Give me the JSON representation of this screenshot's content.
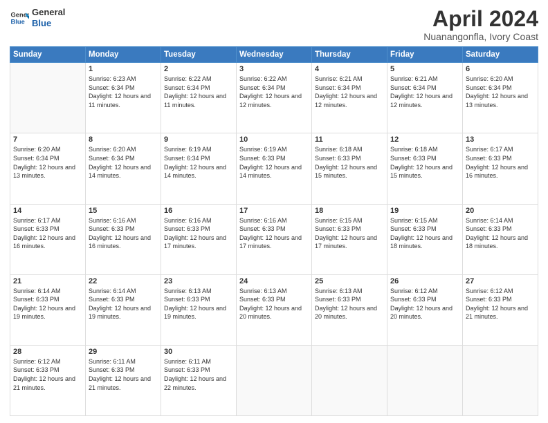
{
  "logo": {
    "line1": "General",
    "line2": "Blue"
  },
  "title": "April 2024",
  "subtitle": "Nuanangonfla, Ivory Coast",
  "days_of_week": [
    "Sunday",
    "Monday",
    "Tuesday",
    "Wednesday",
    "Thursday",
    "Friday",
    "Saturday"
  ],
  "weeks": [
    [
      {
        "day": "",
        "sunrise": "",
        "sunset": "",
        "daylight": ""
      },
      {
        "day": "1",
        "sunrise": "6:23 AM",
        "sunset": "6:34 PM",
        "daylight": "12 hours and 11 minutes."
      },
      {
        "day": "2",
        "sunrise": "6:22 AM",
        "sunset": "6:34 PM",
        "daylight": "12 hours and 11 minutes."
      },
      {
        "day": "3",
        "sunrise": "6:22 AM",
        "sunset": "6:34 PM",
        "daylight": "12 hours and 12 minutes."
      },
      {
        "day": "4",
        "sunrise": "6:21 AM",
        "sunset": "6:34 PM",
        "daylight": "12 hours and 12 minutes."
      },
      {
        "day": "5",
        "sunrise": "6:21 AM",
        "sunset": "6:34 PM",
        "daylight": "12 hours and 12 minutes."
      },
      {
        "day": "6",
        "sunrise": "6:20 AM",
        "sunset": "6:34 PM",
        "daylight": "12 hours and 13 minutes."
      }
    ],
    [
      {
        "day": "7",
        "sunrise": "6:20 AM",
        "sunset": "6:34 PM",
        "daylight": "12 hours and 13 minutes."
      },
      {
        "day": "8",
        "sunrise": "6:20 AM",
        "sunset": "6:34 PM",
        "daylight": "12 hours and 14 minutes."
      },
      {
        "day": "9",
        "sunrise": "6:19 AM",
        "sunset": "6:34 PM",
        "daylight": "12 hours and 14 minutes."
      },
      {
        "day": "10",
        "sunrise": "6:19 AM",
        "sunset": "6:33 PM",
        "daylight": "12 hours and 14 minutes."
      },
      {
        "day": "11",
        "sunrise": "6:18 AM",
        "sunset": "6:33 PM",
        "daylight": "12 hours and 15 minutes."
      },
      {
        "day": "12",
        "sunrise": "6:18 AM",
        "sunset": "6:33 PM",
        "daylight": "12 hours and 15 minutes."
      },
      {
        "day": "13",
        "sunrise": "6:17 AM",
        "sunset": "6:33 PM",
        "daylight": "12 hours and 16 minutes."
      }
    ],
    [
      {
        "day": "14",
        "sunrise": "6:17 AM",
        "sunset": "6:33 PM",
        "daylight": "12 hours and 16 minutes."
      },
      {
        "day": "15",
        "sunrise": "6:16 AM",
        "sunset": "6:33 PM",
        "daylight": "12 hours and 16 minutes."
      },
      {
        "day": "16",
        "sunrise": "6:16 AM",
        "sunset": "6:33 PM",
        "daylight": "12 hours and 17 minutes."
      },
      {
        "day": "17",
        "sunrise": "6:16 AM",
        "sunset": "6:33 PM",
        "daylight": "12 hours and 17 minutes."
      },
      {
        "day": "18",
        "sunrise": "6:15 AM",
        "sunset": "6:33 PM",
        "daylight": "12 hours and 17 minutes."
      },
      {
        "day": "19",
        "sunrise": "6:15 AM",
        "sunset": "6:33 PM",
        "daylight": "12 hours and 18 minutes."
      },
      {
        "day": "20",
        "sunrise": "6:14 AM",
        "sunset": "6:33 PM",
        "daylight": "12 hours and 18 minutes."
      }
    ],
    [
      {
        "day": "21",
        "sunrise": "6:14 AM",
        "sunset": "6:33 PM",
        "daylight": "12 hours and 19 minutes."
      },
      {
        "day": "22",
        "sunrise": "6:14 AM",
        "sunset": "6:33 PM",
        "daylight": "12 hours and 19 minutes."
      },
      {
        "day": "23",
        "sunrise": "6:13 AM",
        "sunset": "6:33 PM",
        "daylight": "12 hours and 19 minutes."
      },
      {
        "day": "24",
        "sunrise": "6:13 AM",
        "sunset": "6:33 PM",
        "daylight": "12 hours and 20 minutes."
      },
      {
        "day": "25",
        "sunrise": "6:13 AM",
        "sunset": "6:33 PM",
        "daylight": "12 hours and 20 minutes."
      },
      {
        "day": "26",
        "sunrise": "6:12 AM",
        "sunset": "6:33 PM",
        "daylight": "12 hours and 20 minutes."
      },
      {
        "day": "27",
        "sunrise": "6:12 AM",
        "sunset": "6:33 PM",
        "daylight": "12 hours and 21 minutes."
      }
    ],
    [
      {
        "day": "28",
        "sunrise": "6:12 AM",
        "sunset": "6:33 PM",
        "daylight": "12 hours and 21 minutes."
      },
      {
        "day": "29",
        "sunrise": "6:11 AM",
        "sunset": "6:33 PM",
        "daylight": "12 hours and 21 minutes."
      },
      {
        "day": "30",
        "sunrise": "6:11 AM",
        "sunset": "6:33 PM",
        "daylight": "12 hours and 22 minutes."
      },
      {
        "day": "",
        "sunrise": "",
        "sunset": "",
        "daylight": ""
      },
      {
        "day": "",
        "sunrise": "",
        "sunset": "",
        "daylight": ""
      },
      {
        "day": "",
        "sunrise": "",
        "sunset": "",
        "daylight": ""
      },
      {
        "day": "",
        "sunrise": "",
        "sunset": "",
        "daylight": ""
      }
    ]
  ],
  "labels": {
    "sunrise_prefix": "Sunrise: ",
    "sunset_prefix": "Sunset: ",
    "daylight_prefix": "Daylight: "
  }
}
